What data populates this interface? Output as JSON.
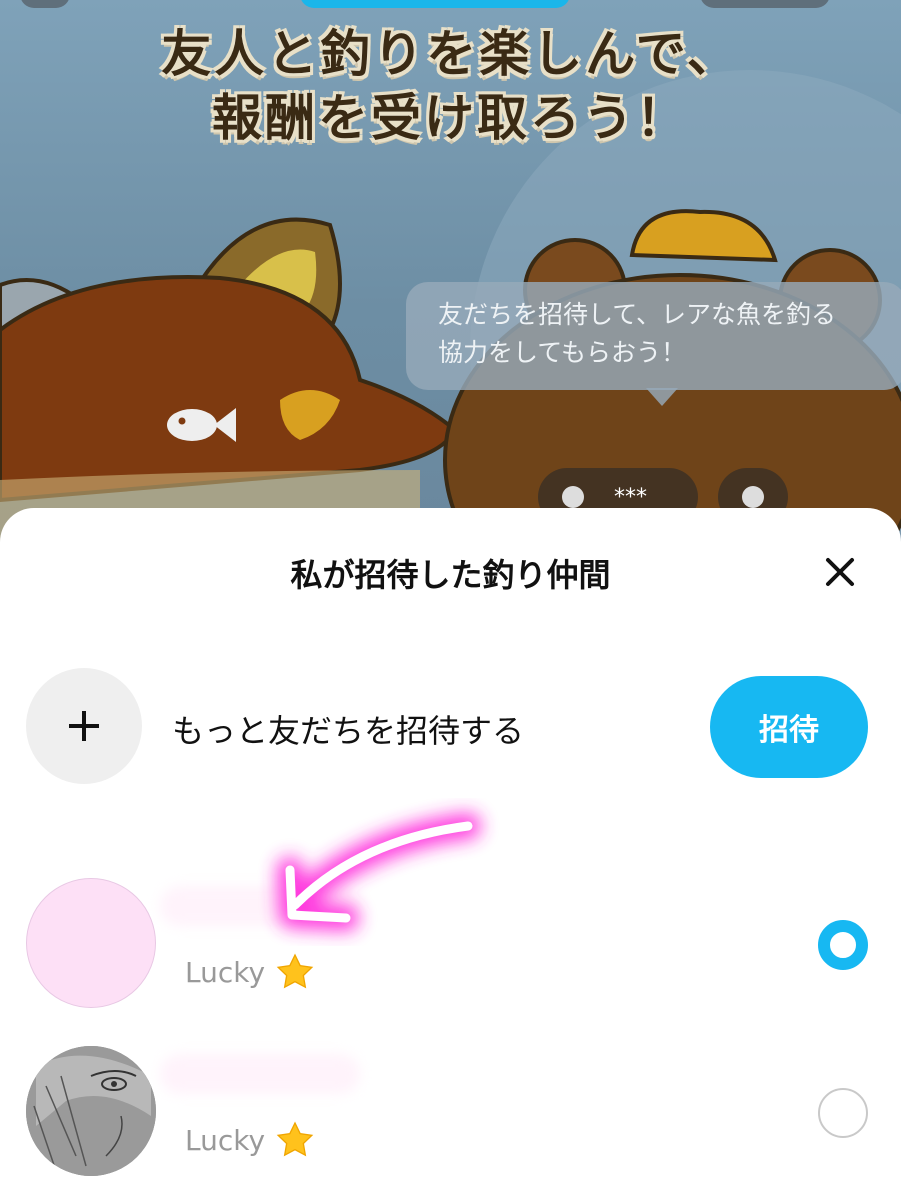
{
  "hero": {
    "title_line1": "友人と釣りを楽しんで、",
    "title_line2": "報酬を受け取ろう！",
    "bubble_line1": "友だちを招待して、レアな魚を釣る",
    "bubble_line2": "協力をしてもらおう！",
    "mini_pill_text": "***"
  },
  "sheet": {
    "title": "私が招待した釣り仲間",
    "invite_label": "もっと友だちを招待する",
    "invite_button": "招待",
    "friends": [
      {
        "rank": "Lucky",
        "badge": "star-icon",
        "selected": true
      },
      {
        "rank": "Lucky",
        "badge": "star-icon",
        "selected": false
      }
    ]
  },
  "colors": {
    "accent": "#17b8f2",
    "annotation": "#ff44dd"
  }
}
